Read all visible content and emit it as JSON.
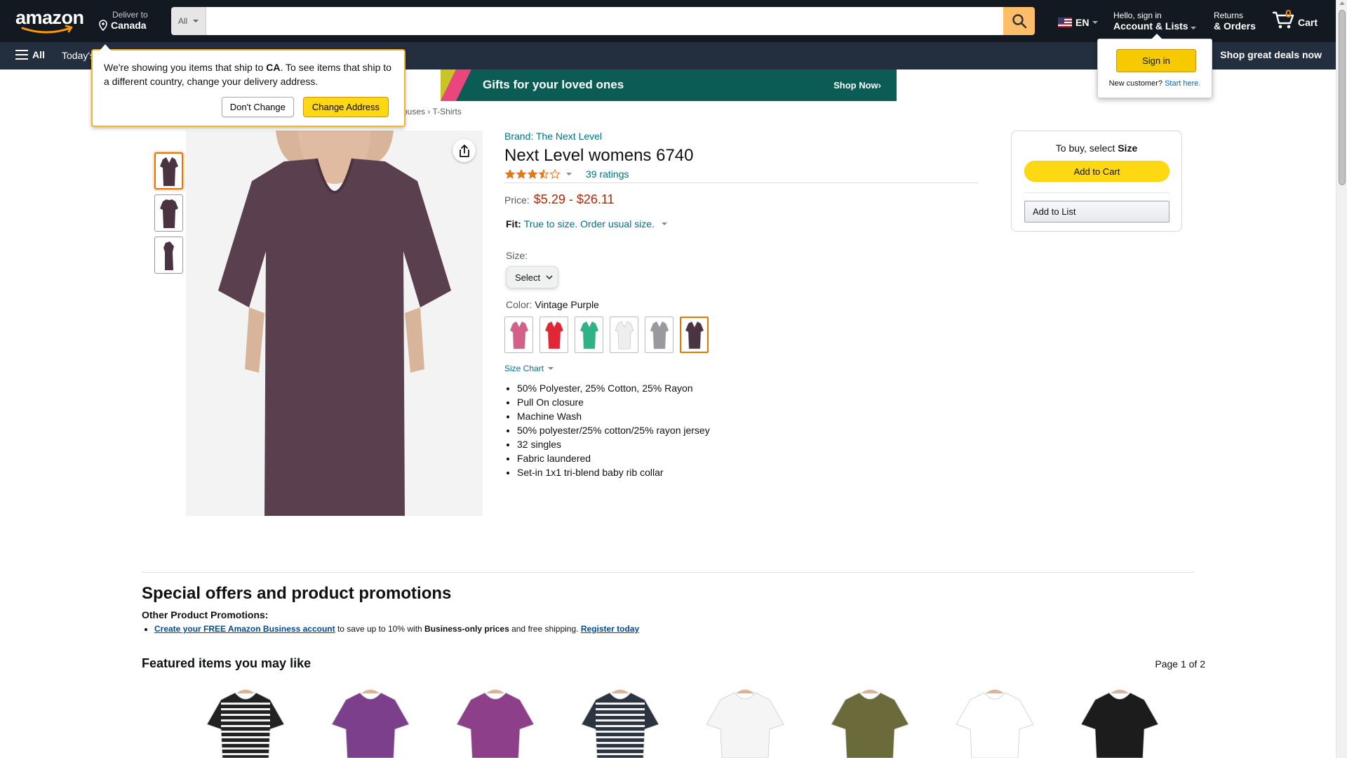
{
  "header": {
    "deliver_line1": "Deliver to",
    "deliver_line2": "Canada",
    "search_category": "All",
    "search_placeholder": "",
    "lang": "EN",
    "account_line1": "Hello, sign in",
    "account_line2": "Account & Lists",
    "returns_line1": "Returns",
    "returns_line2": "& Orders",
    "cart_count": "0",
    "cart_label": "Cart"
  },
  "nav": {
    "all_label": "All",
    "today_label": "Today's Deals",
    "shop_deals": "Shop great deals now"
  },
  "banner": {
    "title": "Gifts for your loved ones",
    "cta": "Shop Now›"
  },
  "popover": {
    "text_pre": "We're showing you items that ship to ",
    "country": "CA",
    "text_post": ". To see items that ship to a different country, change your delivery address.",
    "dont_change": "Don't Change",
    "change_address": "Change Address"
  },
  "signin": {
    "button": "Sign in",
    "new_customer": "New customer?",
    "start_here": "Start here."
  },
  "breadcrumb": {
    "items": [
      "ouses",
      "T-Shirts"
    ],
    "sep": "›"
  },
  "product": {
    "brand": "Brand: The Next Level",
    "title": "Next Level womens 6740",
    "rating_value": 3.5,
    "ratings_count": "39 ratings",
    "price_label": "Price:",
    "price_value": "$5.29 - $26.11",
    "fit_label": "Fit:",
    "fit_value": "True to size. Order usual size.",
    "size_label": "Size:",
    "size_select": "Select",
    "color_label": "Color:",
    "color_value": "Vintage Purple",
    "swatches": [
      {
        "color": "#d45f8a"
      },
      {
        "color": "#e32636"
      },
      {
        "color": "#2eb389"
      },
      {
        "color": "#eeeeee"
      },
      {
        "color": "#9a9a9e"
      },
      {
        "color": "#4a3442"
      }
    ],
    "size_chart": "Size Chart",
    "bullets": [
      "50% Polyester, 25% Cotton, 25% Rayon",
      "Pull On closure",
      "Machine Wash",
      "50% polyester/25% cotton/25% rayon jersey",
      "32 singles",
      "Fabric laundered",
      "Set-in 1x1 tri-blend baby rib collar"
    ]
  },
  "buybox": {
    "to_buy_pre": "To buy, select ",
    "to_buy_bold": "Size",
    "add_to_cart": "Add to Cart",
    "add_to_list": "Add to List"
  },
  "promotions": {
    "heading": "Special offers and product promotions",
    "sub": "Other Product Promotions:",
    "link1": "Create your FREE Amazon Business account",
    "mid": " to save up to 10% with ",
    "bold": "Business-only prices",
    "post": " and free shipping. ",
    "link2": "Register today"
  },
  "featured": {
    "heading": "Featured items you may like",
    "page": "Page 1 of 2",
    "items": [
      {
        "color": "#222222",
        "stripe": true
      },
      {
        "color": "#7b3f8c"
      },
      {
        "color": "#8e3f8a"
      },
      {
        "color": "#2c3440",
        "stripe": true
      },
      {
        "color": "#f5f5f5"
      },
      {
        "color": "#6b6a3a"
      },
      {
        "color": "#ffffff"
      },
      {
        "color": "#1c1c1c"
      }
    ]
  },
  "colors": {
    "nav_belt": "#131921",
    "nav_main": "#232f3e",
    "link": "#007185",
    "price": "#B12704",
    "accent_yellow": "#FFD814",
    "search_button": "#febd69"
  }
}
